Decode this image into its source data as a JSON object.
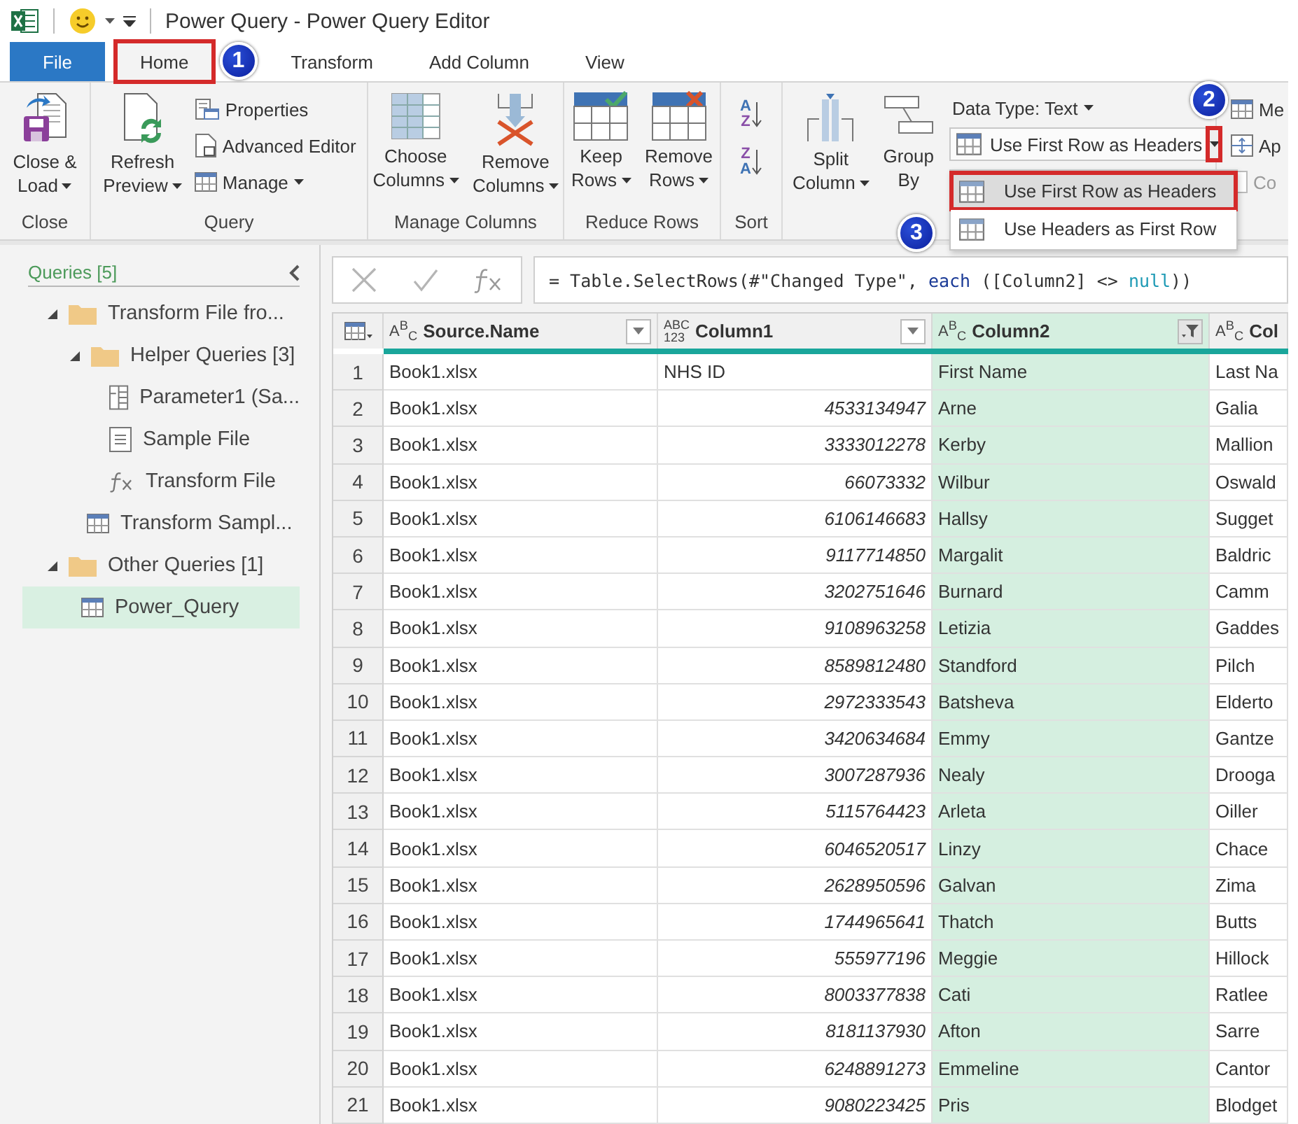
{
  "title_bar": {
    "title": "Power Query - Power Query Editor"
  },
  "tabs": [
    {
      "kind": "file",
      "label": "File",
      "selected": false,
      "highlighted": false
    },
    {
      "kind": "tab",
      "label": "Home",
      "selected": true,
      "highlighted": true,
      "callout": "1"
    },
    {
      "kind": "tab",
      "label": "Transform",
      "selected": false,
      "highlighted": false
    },
    {
      "kind": "tab",
      "label": "Add Column",
      "selected": false,
      "highlighted": false
    },
    {
      "kind": "tab",
      "label": "View",
      "selected": false,
      "highlighted": false
    }
  ],
  "ribbon": {
    "groups": [
      {
        "label": "Close",
        "items": [
          {
            "kind": "large",
            "lines": [
              "Close &",
              "Load"
            ],
            "dropdown": true
          }
        ]
      },
      {
        "label": "Query",
        "items": [
          {
            "kind": "large",
            "lines": [
              "Refresh",
              "Preview"
            ],
            "dropdown": true
          },
          {
            "kind": "stack",
            "buttons": [
              {
                "label": "Properties",
                "dropdown": false,
                "disabled": false
              },
              {
                "label": "Advanced Editor",
                "dropdown": false,
                "disabled": false
              },
              {
                "label": "Manage",
                "dropdown": true,
                "disabled": false
              }
            ]
          }
        ]
      },
      {
        "label": "Manage Columns",
        "items": [
          {
            "kind": "large",
            "lines": [
              "Choose",
              "Columns"
            ],
            "dropdown": true
          },
          {
            "kind": "large",
            "lines": [
              "Remove",
              "Columns"
            ],
            "dropdown": true
          }
        ]
      },
      {
        "label": "Reduce Rows",
        "items": [
          {
            "kind": "large",
            "lines": [
              "Keep",
              "Rows"
            ],
            "dropdown": true
          },
          {
            "kind": "large",
            "lines": [
              "Remove",
              "Rows"
            ],
            "dropdown": true
          }
        ]
      },
      {
        "label": "Sort",
        "items": [
          {
            "kind": "sort",
            "buttons": [
              {
                "top": "A",
                "bottom": "Z"
              },
              {
                "top": "Z",
                "bottom": "A"
              }
            ]
          }
        ]
      },
      {
        "items": [
          {
            "kind": "large",
            "lines": [
              "Split",
              "Column"
            ],
            "dropdown": true
          },
          {
            "kind": "large",
            "lines": [
              "Group",
              "By"
            ],
            "dropdown": false
          },
          {
            "kind": "transform",
            "data_type": {
              "label": "Data Type: Text",
              "dropdown": true
            },
            "split_button": {
              "label": "Use First Row as Headers",
              "highlighted": true,
              "callout": "2"
            },
            "menu": [
              {
                "label": "Use First Row as Headers",
                "selected": true,
                "highlighted": true,
                "callout": "3"
              },
              {
                "label": "Use Headers as First Row",
                "selected": false,
                "highlighted": false
              }
            ]
          }
        ]
      },
      {
        "items": [
          {
            "kind": "stack",
            "buttons": [
              {
                "label": "Me",
                "dropdown": false,
                "disabled": false
              },
              {
                "label": "Ap",
                "dropdown": false,
                "disabled": false
              },
              {
                "label": "Co",
                "dropdown": false,
                "disabled": true
              }
            ]
          }
        ]
      }
    ]
  },
  "queries": {
    "title": "Queries [5]",
    "tree": [
      {
        "kind": "folder",
        "label": "Transform File fro...",
        "expanded": true,
        "selected": false,
        "children": [
          {
            "kind": "folder",
            "label": "Helper Queries [3]",
            "expanded": true,
            "selected": false,
            "children": [
              {
                "kind": "parameter",
                "label": "Parameter1 (Sa...",
                "selected": false
              },
              {
                "kind": "file",
                "label": "Sample File",
                "selected": false
              },
              {
                "kind": "function",
                "label": "Transform File",
                "selected": false
              }
            ]
          },
          {
            "kind": "table",
            "label": "Transform Sampl...",
            "selected": false
          }
        ]
      },
      {
        "kind": "folder",
        "label": "Other Queries [1]",
        "expanded": true,
        "selected": false,
        "children": [
          {
            "kind": "table",
            "label": "Power_Query",
            "selected": true
          }
        ]
      }
    ]
  },
  "formula": [
    {
      "kind": "plain",
      "text": "= Table.SelectRows(#\"Changed Type\", "
    },
    {
      "kind": "keyword",
      "text": "each"
    },
    {
      "kind": "plain",
      "text": " ([Column2] <> "
    },
    {
      "kind": "literal",
      "text": "null"
    },
    {
      "kind": "plain",
      "text": "))"
    }
  ],
  "table": {
    "columns": [
      {
        "type_glyph": [
          "A$^{B}$$_{C}$"
        ],
        "name": "Source.Name",
        "selected": false,
        "filtered": false,
        "menu_button": true
      },
      {
        "type_glyph": [
          "ABC",
          "123"
        ],
        "name": "Column1",
        "selected": false,
        "filtered": false,
        "menu_button": true
      },
      {
        "type_glyph": [
          "A$^{B}$$_{C}$"
        ],
        "name": "Column2",
        "selected": true,
        "filtered": true,
        "menu_button": true
      },
      {
        "type_glyph": [
          "A$^{B}$$_{C}$"
        ],
        "name": "Col",
        "selected": false,
        "menu_button": false
      }
    ],
    "rows": [
      {
        "n": "1",
        "column1_numeric": false,
        "cells": [
          "Book1.xlsx",
          "NHS ID",
          "First Name",
          "Last Na"
        ]
      },
      {
        "n": "2",
        "column1_numeric": true,
        "cells": [
          "Book1.xlsx",
          "4533134947",
          "Arne",
          "Galia"
        ]
      },
      {
        "n": "3",
        "column1_numeric": true,
        "cells": [
          "Book1.xlsx",
          "3333012278",
          "Kerby",
          "Mallion"
        ]
      },
      {
        "n": "4",
        "column1_numeric": true,
        "cells": [
          "Book1.xlsx",
          "66073332",
          "Wilbur",
          "Oswald"
        ]
      },
      {
        "n": "5",
        "column1_numeric": true,
        "cells": [
          "Book1.xlsx",
          "6106146683",
          "Hallsy",
          "Sugget"
        ]
      },
      {
        "n": "6",
        "column1_numeric": true,
        "cells": [
          "Book1.xlsx",
          "9117714850",
          "Margalit",
          "Baldric"
        ]
      },
      {
        "n": "7",
        "column1_numeric": true,
        "cells": [
          "Book1.xlsx",
          "3202751646",
          "Burnard",
          "Camm"
        ]
      },
      {
        "n": "8",
        "column1_numeric": true,
        "cells": [
          "Book1.xlsx",
          "9108963258",
          "Letizia",
          "Gaddes"
        ]
      },
      {
        "n": "9",
        "column1_numeric": true,
        "cells": [
          "Book1.xlsx",
          "8589812480",
          "Standford",
          "Pilch"
        ]
      },
      {
        "n": "10",
        "column1_numeric": true,
        "cells": [
          "Book1.xlsx",
          "2972333543",
          "Batsheva",
          "Elderto"
        ]
      },
      {
        "n": "11",
        "column1_numeric": true,
        "cells": [
          "Book1.xlsx",
          "3420634684",
          "Emmy",
          "Gantze"
        ]
      },
      {
        "n": "12",
        "column1_numeric": true,
        "cells": [
          "Book1.xlsx",
          "3007287936",
          "Nealy",
          "Drooga"
        ]
      },
      {
        "n": "13",
        "column1_numeric": true,
        "cells": [
          "Book1.xlsx",
          "5115764423",
          "Arleta",
          "Oiller"
        ]
      },
      {
        "n": "14",
        "column1_numeric": true,
        "cells": [
          "Book1.xlsx",
          "6046520517",
          "Linzy",
          "Chace"
        ]
      },
      {
        "n": "15",
        "column1_numeric": true,
        "cells": [
          "Book1.xlsx",
          "2628950596",
          "Galvan",
          "Zima"
        ]
      },
      {
        "n": "16",
        "column1_numeric": true,
        "cells": [
          "Book1.xlsx",
          "1744965641",
          "Thatch",
          "Butts"
        ]
      },
      {
        "n": "17",
        "column1_numeric": true,
        "cells": [
          "Book1.xlsx",
          "555977196",
          "Meggie",
          "Hillock"
        ]
      },
      {
        "n": "18",
        "column1_numeric": true,
        "cells": [
          "Book1.xlsx",
          "8003377838",
          "Cati",
          "Ratlee"
        ]
      },
      {
        "n": "19",
        "column1_numeric": true,
        "cells": [
          "Book1.xlsx",
          "8181137930",
          "Afton",
          "Sarre"
        ]
      },
      {
        "n": "20",
        "column1_numeric": true,
        "cells": [
          "Book1.xlsx",
          "6248891273",
          "Emmeline",
          "Cantor"
        ]
      },
      {
        "n": "21",
        "column1_numeric": true,
        "cells": [
          "Book1.xlsx",
          "9080223425",
          "Pris",
          "Blodget"
        ]
      }
    ]
  }
}
